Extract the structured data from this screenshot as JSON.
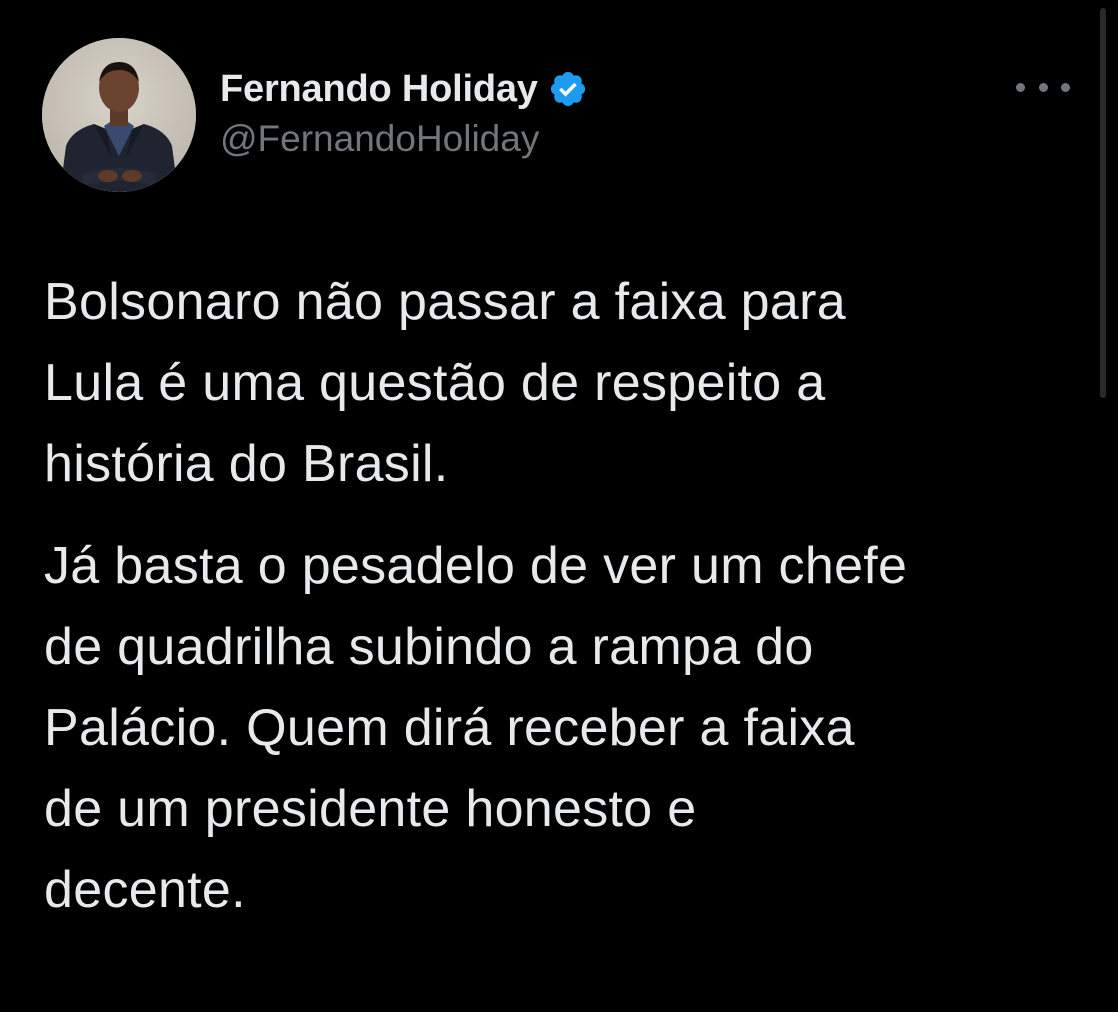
{
  "tweet": {
    "author": {
      "display_name": "Fernando Holiday",
      "handle": "@FernandoHoliday",
      "verified": true,
      "avatar_icon": "profile-photo"
    },
    "more_icon": "ellipsis-icon",
    "paragraphs": [
      "Bolsonaro não passar a faixa para\nLula é uma questão de respeito a\nhistória do Brasil.",
      "Já basta o pesadelo de ver um chefe\nde quadrilha subindo a rampa do\nPalácio. Quem dirá receber a faixa\nde um presidente honesto e\ndecente."
    ]
  },
  "colors": {
    "background": "#000000",
    "text_primary": "#e7e9ea",
    "text_secondary": "#71767b",
    "verified_badge": "#1d9bf0"
  }
}
